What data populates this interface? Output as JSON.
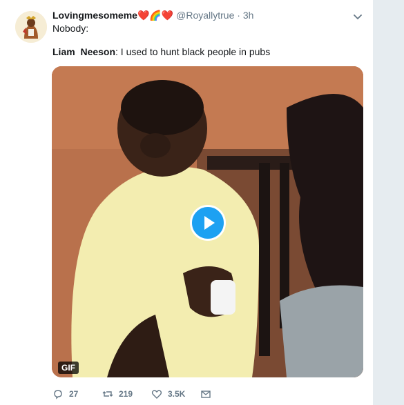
{
  "tweet": {
    "display_name": "Lovingmesomeme",
    "name_emoji": "❤️🌈❤️",
    "handle": "@Royallytrue",
    "separator": "·",
    "time": "3h",
    "line1": "Nobody:",
    "line2_speaker": "Liam  Neeson",
    "line2_text": ": I used to hunt black people in pubs"
  },
  "media": {
    "badge": "GIF",
    "play_icon": "play-icon"
  },
  "actions": {
    "replies": "27",
    "retweets": "219",
    "likes": "3.5K"
  },
  "colors": {
    "accent": "#1da1f2",
    "muted": "#657786",
    "text": "#14171a"
  }
}
